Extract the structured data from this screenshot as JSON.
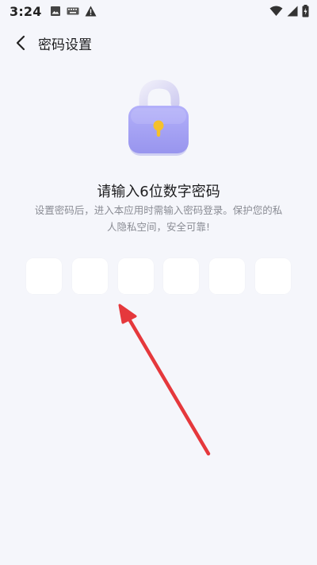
{
  "status_bar": {
    "time": "3:24",
    "left_icons": [
      "image-icon",
      "keyboard-icon",
      "warning-icon"
    ],
    "right_icons": [
      "wifi-icon",
      "signal-icon",
      "battery-icon"
    ]
  },
  "app_bar": {
    "back_icon": "chevron-left-icon",
    "title": "密码设置"
  },
  "illustration": {
    "icon": "padlock-unlocked-icon",
    "body_color": "#a9a6f5",
    "shackle_color": "#dcd9f6",
    "keyhole_color": "#f5c12b"
  },
  "heading": "请输入6位数字密码",
  "description_lines": [
    "设置密码后，进入本应用时需输入密码登录。保护您的私",
    "人隐私空间，安全可靠!"
  ],
  "pin_inputs": [
    {
      "value": ""
    },
    {
      "value": ""
    },
    {
      "value": ""
    },
    {
      "value": ""
    },
    {
      "value": ""
    },
    {
      "value": ""
    }
  ],
  "annotation": {
    "icon": "arrow-icon",
    "color": "#e5383c"
  },
  "colors": {
    "background": "#f5f6fb",
    "input_background": "#ffffff",
    "text_primary": "#1d1d1f",
    "text_secondary": "#8a8c94"
  }
}
